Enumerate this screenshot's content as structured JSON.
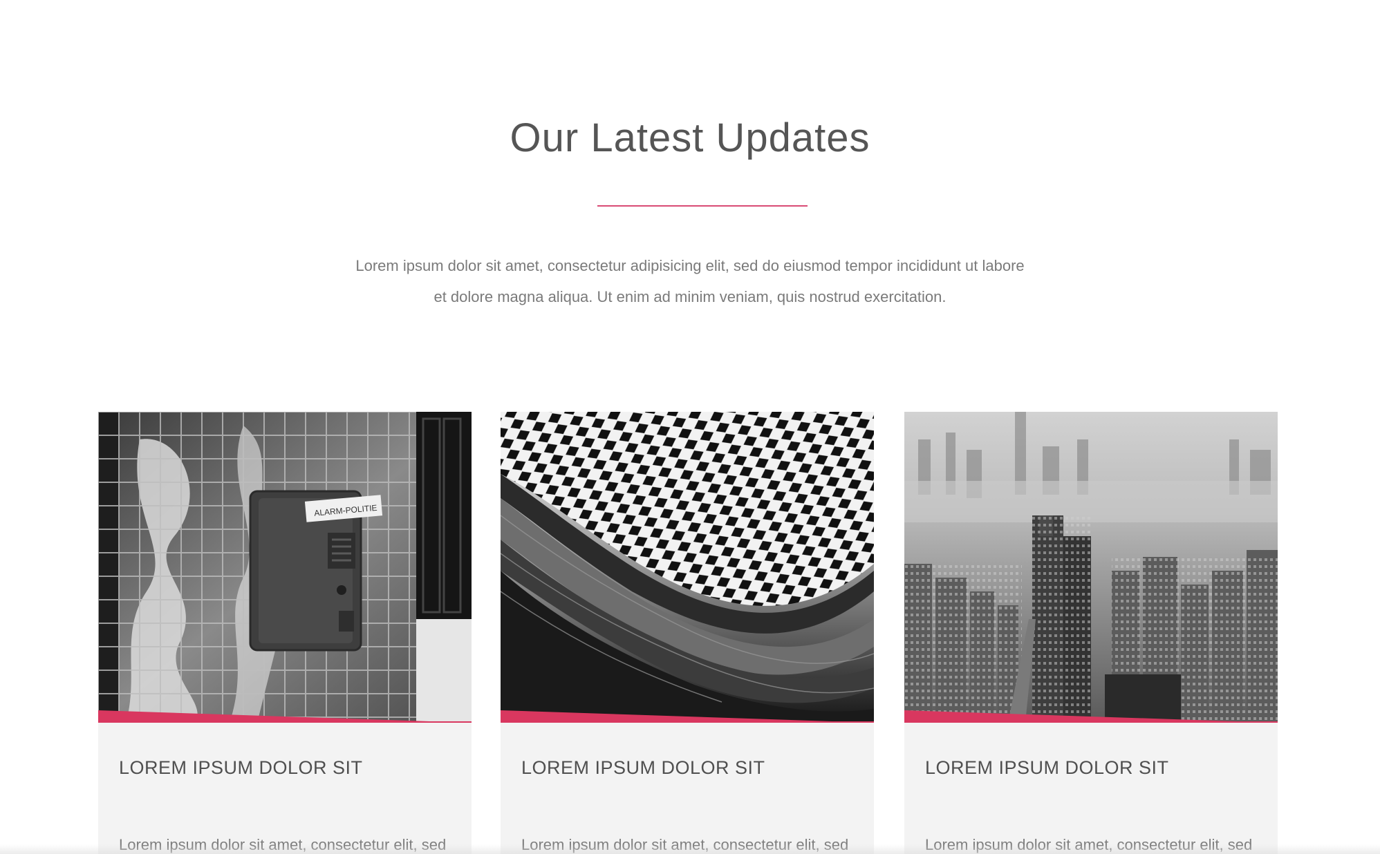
{
  "section": {
    "title": "Our Latest Updates",
    "intro_line1": "Lorem ipsum dolor sit amet, consectetur adipisicing elit, sed do eiusmod tempor incididunt ut labore",
    "intro_line2": "et dolore magna aliqua. Ut enim ad minim veniam, quis nostrud exercitation."
  },
  "colors": {
    "accent": "#d9375f",
    "card_bg": "#f3f3f3",
    "title_text": "#555555",
    "body_text": "#7a7a7a"
  },
  "cards": [
    {
      "title": "LOREM IPSUM DOLOR SIT",
      "excerpt": "Lorem ipsum dolor sit amet, consectetur elit, sed",
      "image": "alarm-box-photo"
    },
    {
      "title": "LOREM IPSUM DOLOR SIT",
      "excerpt": "Lorem ipsum dolor sit amet, consectetur elit, sed",
      "image": "wave-architecture-photo"
    },
    {
      "title": "LOREM IPSUM DOLOR SIT",
      "excerpt": "Lorem ipsum dolor sit amet, consectetur elit, sed",
      "image": "city-skyline-photo"
    }
  ]
}
